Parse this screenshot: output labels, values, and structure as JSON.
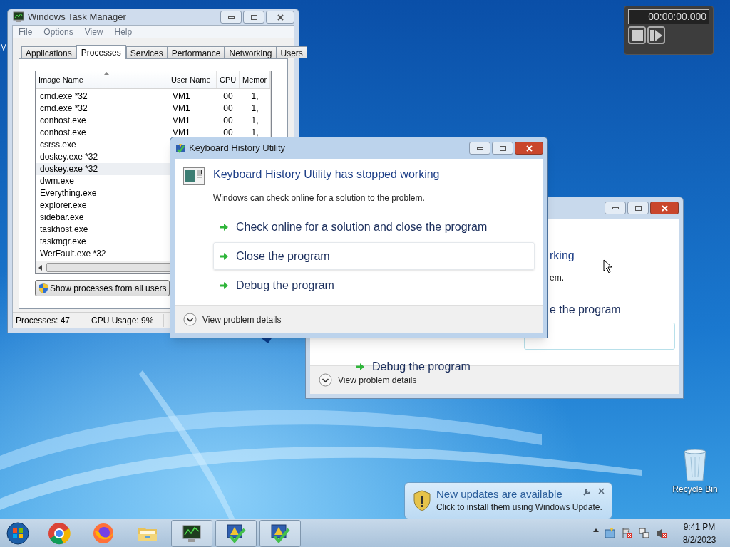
{
  "desktop": {
    "cut_icon_label": "M"
  },
  "task_manager": {
    "title": "Windows Task Manager",
    "menu": [
      "File",
      "Options",
      "View",
      "Help"
    ],
    "tabs": [
      {
        "label": "Applications",
        "selected": false
      },
      {
        "label": "Processes",
        "selected": true
      },
      {
        "label": "Services",
        "selected": false
      },
      {
        "label": "Performance",
        "selected": false
      },
      {
        "label": "Networking",
        "selected": false
      },
      {
        "label": "Users",
        "selected": false
      }
    ],
    "columns": [
      "Image Name",
      "User Name",
      "CPU",
      "Memor"
    ],
    "rows": [
      {
        "cells": [
          "cmd.exe *32",
          "VM1",
          "00",
          "1,"
        ],
        "selected": false
      },
      {
        "cells": [
          "cmd.exe *32",
          "VM1",
          "00",
          "1,"
        ],
        "selected": false
      },
      {
        "cells": [
          "conhost.exe",
          "VM1",
          "00",
          "1,"
        ],
        "selected": false
      },
      {
        "cells": [
          "conhost.exe",
          "VM1",
          "00",
          "1,"
        ],
        "selected": false
      },
      {
        "cells": [
          "csrss.exe"
        ],
        "selected": false
      },
      {
        "cells": [
          "doskey.exe *32"
        ],
        "selected": false
      },
      {
        "cells": [
          "doskey.exe *32"
        ],
        "selected": true
      },
      {
        "cells": [
          "dwm.exe"
        ],
        "selected": false
      },
      {
        "cells": [
          "Everything.exe"
        ],
        "selected": false
      },
      {
        "cells": [
          "explorer.exe"
        ],
        "selected": false
      },
      {
        "cells": [
          "sidebar.exe"
        ],
        "selected": false
      },
      {
        "cells": [
          "taskhost.exe"
        ],
        "selected": false
      },
      {
        "cells": [
          "taskmgr.exe"
        ],
        "selected": false
      },
      {
        "cells": [
          "WerFault.exe *32"
        ],
        "selected": false
      }
    ],
    "button": "Show processes from all users",
    "status": [
      "Processes: 47",
      "CPU Usage: 9%"
    ]
  },
  "timer": {
    "display": "00:00:00.000"
  },
  "back_dialog": {
    "heading_end": "rking",
    "text_end": "em.",
    "option_end": "e the program",
    "options": [
      "Debug the program"
    ],
    "details": "View problem details"
  },
  "dialog": {
    "title": "Keyboard History Utility",
    "heading": "Keyboard History Utility has stopped working",
    "text": "Windows can check online for a solution to the problem.",
    "options": [
      {
        "label": "Check online for a solution and close the program",
        "focused": false
      },
      {
        "label": "Close the program",
        "focused": true
      },
      {
        "label": "Debug the program",
        "focused": false
      }
    ],
    "details": "View problem details"
  },
  "recycle_bin": {
    "label": "Recycle Bin"
  },
  "notification": {
    "title": "New updates are available",
    "text": "Click to install them using Windows Update."
  },
  "taskbar": {
    "items": [
      {
        "kind": "start",
        "running": false
      },
      {
        "kind": "chrome",
        "running": false
      },
      {
        "kind": "firefox",
        "running": false
      },
      {
        "kind": "explorer",
        "running": false
      },
      {
        "kind": "taskmgr",
        "running": true
      },
      {
        "kind": "werfault",
        "running": true
      },
      {
        "kind": "werfault",
        "running": true
      }
    ],
    "tray": [
      {
        "kind": "arrow"
      },
      {
        "kind": "update"
      },
      {
        "kind": "flag"
      },
      {
        "kind": "network"
      },
      {
        "kind": "volume"
      }
    ],
    "time": "9:41 PM",
    "date": "8/2/2023"
  }
}
